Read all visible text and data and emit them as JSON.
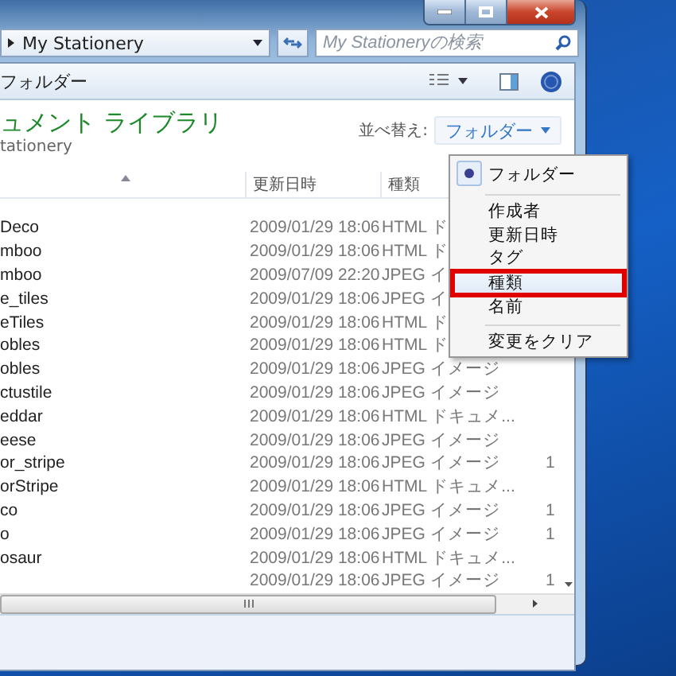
{
  "address_bar": {
    "path": "My Stationery"
  },
  "search": {
    "placeholder": "My Stationeryの検索"
  },
  "toolbar": {
    "folder_label": "フォルダー"
  },
  "library": {
    "title": "ュメント ライブラリ",
    "subtitle": "tationery",
    "sort_label": "並べ替え:",
    "sort_value": "フォルダー"
  },
  "table": {
    "columns": [
      "更新日時",
      "種類"
    ],
    "rows": [
      {
        "name": "Deco",
        "date": "2009/01/29 18:06",
        "type": "HTML ド"
      },
      {
        "name": "mboo",
        "date": "2009/01/29 18:06",
        "type": "HTML ド"
      },
      {
        "name": "mboo",
        "date": "2009/07/09 22:20",
        "type": "JPEG イ"
      },
      {
        "name": "e_tiles",
        "date": "2009/01/29 18:06",
        "type": "JPEG イ"
      },
      {
        "name": "eTiles",
        "date": "2009/01/29 18:06",
        "type": "HTML ド"
      },
      {
        "name": "obles",
        "date": "2009/01/29 18:06",
        "type": "HTML ド"
      },
      {
        "name": "obles",
        "date": "2009/01/29 18:06",
        "type": "JPEG イメージ"
      },
      {
        "name": "ctustile",
        "date": "2009/01/29 18:06",
        "type": "JPEG イメージ"
      },
      {
        "name": "eddar",
        "date": "2009/01/29 18:06",
        "type": "HTML ドキュメ..."
      },
      {
        "name": "eese",
        "date": "2009/01/29 18:06",
        "type": "JPEG イメージ"
      },
      {
        "name": "or_stripe",
        "date": "2009/01/29 18:06",
        "type": "JPEG イメージ",
        "column_4": "1"
      },
      {
        "name": "orStripe",
        "date": "2009/01/29 18:06",
        "type": "HTML ドキュメ..."
      },
      {
        "name": "co",
        "date": "2009/01/29 18:06",
        "type": "JPEG イメージ",
        "column_4": "1"
      },
      {
        "name": "o",
        "date": "2009/01/29 18:06",
        "type": "JPEG イメージ",
        "column_4": "1"
      },
      {
        "name": "osaur",
        "date": "2009/01/29 18:06",
        "type": "HTML ドキュメ..."
      },
      {
        "date": "2009/01/29 18:06",
        "type": "JPEG イメージ",
        "column_4": "1"
      }
    ]
  },
  "sort_menu": {
    "items": [
      {
        "kind": "radio",
        "label": "フォルダー",
        "selected": true,
        "highlighted": false
      },
      {
        "kind": "separator"
      },
      {
        "kind": "item",
        "label": "作成者",
        "highlighted": false
      },
      {
        "kind": "item",
        "label": "更新日時",
        "highlighted": false
      },
      {
        "kind": "item",
        "label": "タグ",
        "highlighted": false
      },
      {
        "kind": "item",
        "label": "種類",
        "highlighted": true
      },
      {
        "kind": "item",
        "label": "名前",
        "highlighted": false
      },
      {
        "kind": "separator"
      },
      {
        "kind": "item",
        "label": "変更をクリア",
        "highlighted": false
      }
    ]
  }
}
